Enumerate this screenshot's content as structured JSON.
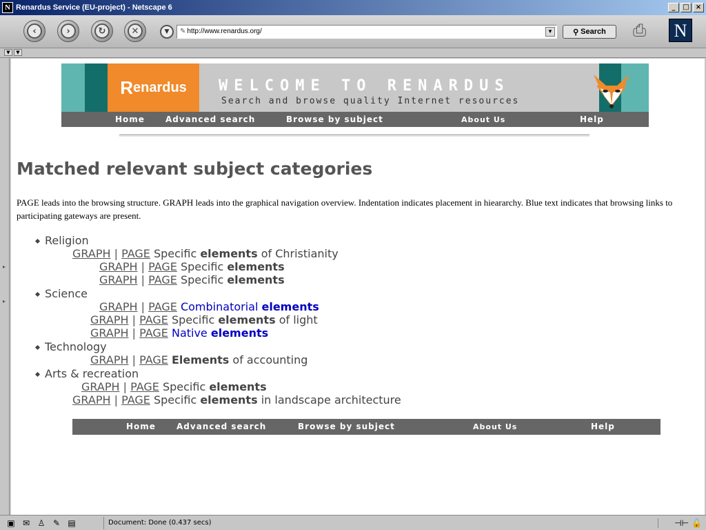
{
  "window": {
    "title": "Renardus Service (EU-project) - Netscape 6",
    "app_icon": "N"
  },
  "toolbar": {
    "url": "http://www.renardus.org/",
    "search_label": "Search",
    "logo_letter": "N"
  },
  "banner": {
    "logo_first": "R",
    "logo_rest": "enardus",
    "welcome": "WELCOME TO RENARDUS",
    "tagline": "Search and browse quality Internet resources"
  },
  "nav": {
    "home": "Home",
    "advanced": "Advanced search",
    "browse": "Browse by subject",
    "about": "About Us",
    "help": "Help"
  },
  "page": {
    "heading": "Matched relevant subject categories",
    "intro": "PAGE leads into the browsing structure. GRAPH leads into the graphical navigation overview. Indentation indicates placement in hieararchy. Blue text indicates that browsing links to participating gateways are present."
  },
  "links": {
    "graph": "GRAPH",
    "page": "PAGE",
    "sep": "|"
  },
  "categories": [
    {
      "name": "Religion",
      "items": [
        {
          "pre": "Specific ",
          "bold": "elements",
          "post": " of Christianity",
          "blue": false
        },
        {
          "pre": "Specific ",
          "bold": "elements",
          "post": "",
          "blue": false
        },
        {
          "pre": "Specific ",
          "bold": "elements",
          "post": "",
          "blue": false
        }
      ]
    },
    {
      "name": "Science",
      "items": [
        {
          "pre": "Combinatorial ",
          "bold": "elements",
          "post": "",
          "blue": true
        },
        {
          "pre": "Specific ",
          "bold": "elements",
          "post": " of light",
          "blue": false
        },
        {
          "pre": "Native ",
          "bold": "elements",
          "post": "",
          "blue": true
        }
      ]
    },
    {
      "name": "Technology",
      "items": [
        {
          "pre": "",
          "bold": "Elements",
          "post": " of accounting",
          "blue": false
        }
      ]
    },
    {
      "name": "Arts & recreation",
      "items": [
        {
          "pre": "Specific ",
          "bold": "elements",
          "post": "",
          "blue": false
        },
        {
          "pre": "Specific ",
          "bold": "elements",
          "post": " in landscape architecture",
          "blue": false
        }
      ]
    }
  ],
  "status": {
    "text": "Document: Done (0.437 secs)"
  },
  "colors": {
    "accent_orange": "#f08a2a",
    "teal_dark": "#136e6a",
    "teal_light": "#5fb6b0",
    "nav_gray": "#666666",
    "link_blue": "#0000c0"
  }
}
